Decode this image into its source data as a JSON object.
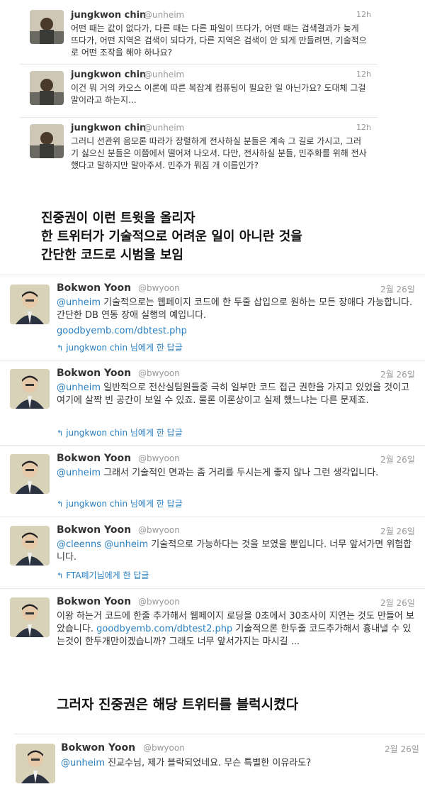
{
  "top_tweets": [
    {
      "name": "jungkwon chin",
      "handle": "@unheim",
      "time": "12h",
      "text": "어떤 때는 값이 없다가, 다른 때는 다른 파일이 뜨다가, 어떤 때는 검색결과가 늦게 뜨다가, 어떤 지역은 검색이 되다가, 다른 지역은 검색이 안 되게 만들려면, 기술적으로 어떤 조작을 해야 하나요?"
    },
    {
      "name": "jungkwon chin",
      "handle": "@unheim",
      "time": "12h",
      "text": "이건 뭐 거의 카오스 이론에 따른 복잡계 컴퓨팅이 필요한 일 아닌가요? 도대체 그걸 말이라고 하는지..."
    },
    {
      "name": "jungkwon chin",
      "handle": "@unheim",
      "time": "12h",
      "text": "그러니 선관위 음모론 따라가 장렬하게 전사하실 분들은 계속 그 길로 가시고, 그러기 싫으신 분들은 이쯤에서 떨어져 나오셔. 다만, 전사하실 분들, 민주화를 위해 전사했다고 말하지만 말아주셔. 민주가 뭐짐 개 이름인가?"
    }
  ],
  "caption1": {
    "line1": "진중권이 이런 트윗을 올리자",
    "line2": "한 트위터가 기술적으로 어려운 일이 아니란 것을",
    "line3": "간단한 코드로 시범을 보임"
  },
  "mid_tweets": [
    {
      "name": "Bokwon Yoon",
      "handle": "@bwyoon",
      "time": "2월 26일",
      "mention": "@unheim",
      "text": " 기술적으로는 웹페이지 코드에 한 두줄 삽입으로 원하는 모든 장애다 가능합니다. 간단한 DB 연동 장애 실행의 예입니다.",
      "link": "goodbyemb.com/dbtest.php",
      "reply": "jungkwon chin 님에게 한 답글"
    },
    {
      "name": "Bokwon Yoon",
      "handle": "@bwyoon",
      "time": "2월 26일",
      "mention": "@unheim",
      "text": " 일반적으로 전산실팀원들중 극히 일부만 코드 접근 권한을 가지고 있었을 것이고 여기에 살짝 빈 공간이 보일 수 있죠. 물론 이론상이고 실제 했느냐는 다른 문제죠.",
      "reply": "jungkwon chin 님에게 한 답글"
    },
    {
      "name": "Bokwon Yoon",
      "handle": "@bwyoon",
      "time": "2월 26일",
      "mention": "@unheim",
      "text": " 그래서 기술적인 면과는 좀 거리를 두시는게 좋지 않나 그런 생각입니다.",
      "reply": "jungkwon chin 님에게 한 답글"
    },
    {
      "name": "Bokwon Yoon",
      "handle": "@bwyoon",
      "time": "2월 26일",
      "mention": "@cleenns @unheim",
      "text": " 기술적으로 가능하다는 것을 보였을 뿐입니다. 너무 앞서가면 위험합니다.",
      "reply": "FTA폐기님에게 한 답글"
    },
    {
      "name": "Bokwon Yoon",
      "handle": "@bwyoon",
      "time": "2월 26일",
      "text_before": "이왕 하는거 코드에 한줄 추가해서 웹페이지 로딩을 0초에서 30초사이 지연는 것도 만들어 보았습니다. ",
      "link": "goodbyemb.com/dbtest2.php",
      "text_after": " 기술적으론 한두줄 코드추가해서 흉내낼 수 있는것이 한두개만이겠습니까? 그래도 너무 앞서가지는 마시길 ..."
    }
  ],
  "caption2": "그러자 진중권은 해당 트위터를 블럭시켰다",
  "last_tweet": {
    "name": "Bokwon Yoon",
    "handle": "@bwyoon",
    "time": "2월 26일",
    "mention": "@unheim",
    "text": " 진교수님, 제가 블락되었네요. 무슨 특별한 이유라도?"
  },
  "icons": {
    "reply": "reply-arrow-icon"
  },
  "colors": {
    "link": "#2a7fbf",
    "muted": "#999999"
  }
}
